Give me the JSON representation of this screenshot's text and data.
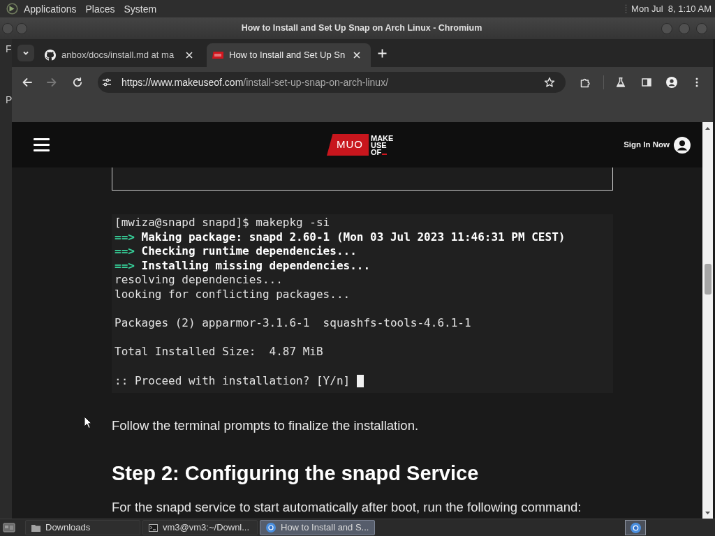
{
  "top_panel": {
    "menus": [
      "Applications",
      "Places",
      "System"
    ],
    "clock": "Mon Jul  8, 1:10 AM"
  },
  "background_window": {
    "texts": [
      "F",
      "P"
    ]
  },
  "window": {
    "title": "How to Install and Set Up Snap on Arch Linux - Chromium"
  },
  "tabs": [
    {
      "kind": "github",
      "title": "anbox/docs/install.md at ma",
      "selected": false
    },
    {
      "kind": "muo",
      "title": "How to Install and Set Up Sn",
      "selected": true
    }
  ],
  "toolbar": {
    "back_disabled": false,
    "forward_disabled": true,
    "url_origin": "https://www.makeuseof.com",
    "url_path": "/install-set-up-snap-on-arch-linux/"
  },
  "site_header": {
    "logo_mark": "MUO",
    "logo_wordmark": [
      "MAKE",
      "USE",
      "OF"
    ],
    "sign_in": "Sign In Now"
  },
  "content": [
    {
      "kind": "frame"
    },
    {
      "kind": "terminal",
      "cursor": true,
      "blocks": [
        [
          {
            "kind": "output",
            "text": "[mwiza@snapd snapd]$ makepkg -si"
          },
          {
            "kind": "step",
            "marker": "==>",
            "text": "Making package: snapd 2.60-1 (Mon 03 Jul 2023 11:46:31 PM CEST)"
          },
          {
            "kind": "step",
            "marker": "==>",
            "text": "Checking runtime dependencies..."
          },
          {
            "kind": "step",
            "marker": "==>",
            "text": "Installing missing dependencies..."
          },
          {
            "kind": "output",
            "text": "resolving dependencies..."
          },
          {
            "kind": "output",
            "text": "looking for conflicting packages..."
          }
        ],
        [
          {
            "kind": "output",
            "text": "Packages (2) apparmor-3.1.6-1  squashfs-tools-4.6.1-1"
          }
        ],
        [
          {
            "kind": "output",
            "text": "Total Installed Size:  4.87 MiB"
          }
        ],
        [
          {
            "kind": "output",
            "text": ":: Proceed with installation? [Y/n]"
          }
        ]
      ]
    },
    {
      "kind": "paragraph",
      "text": "Follow the terminal prompts to finalize the installation."
    },
    {
      "kind": "heading",
      "text": "Step 2: Configuring the snapd Service"
    },
    {
      "kind": "paragraph",
      "text": "For the snapd service to start automatically after boot, run the following command:"
    }
  ],
  "taskbar": {
    "windows": [
      {
        "kind": "folder",
        "title": "Downloads",
        "selected": false
      },
      {
        "kind": "terminal",
        "title": "vm3@vm3:~/Downl...",
        "selected": false
      },
      {
        "kind": "browser",
        "title": "How to Install and S...",
        "selected": true
      }
    ]
  }
}
